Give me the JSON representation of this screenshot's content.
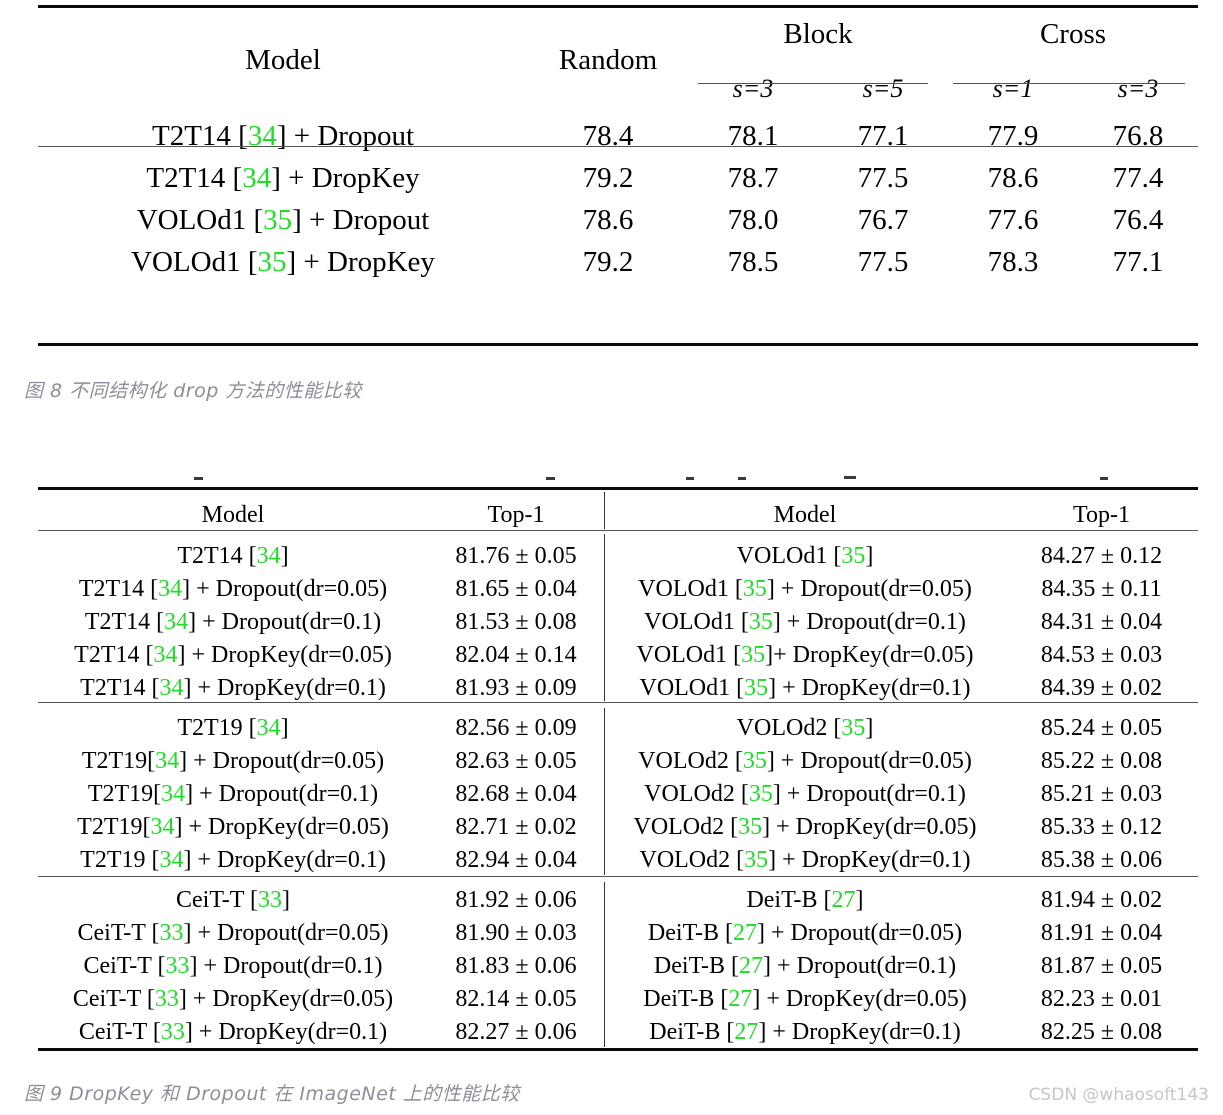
{
  "table1": {
    "columns": {
      "model": "Model",
      "random": "Random",
      "block": "Block",
      "cross": "Cross",
      "sub": [
        "s=3",
        "s=5",
        "s=1",
        "s=3"
      ]
    },
    "rows": [
      {
        "model_prefix": "T2T14 [",
        "cite": "34",
        "model_suffix": "] + Dropout",
        "random": "78.4",
        "block_s3": "78.1",
        "block_s5": "77.1",
        "cross_s1": "77.9",
        "cross_s3": "76.8"
      },
      {
        "model_prefix": "T2T14 [",
        "cite": "34",
        "model_suffix": "] + DropKey",
        "random": "79.2",
        "block_s3": "78.7",
        "block_s5": "77.5",
        "cross_s1": "78.6",
        "cross_s3": "77.4"
      },
      {
        "model_prefix": "VOLOd1 [",
        "cite": "35",
        "model_suffix": "] + Dropout",
        "random": "78.6",
        "block_s3": "78.0",
        "block_s5": "76.7",
        "cross_s1": "77.6",
        "cross_s3": "76.4"
      },
      {
        "model_prefix": "VOLOd1 [",
        "cite": "35",
        "model_suffix": "] + DropKey",
        "random": "79.2",
        "block_s3": "78.5",
        "block_s5": "77.5",
        "cross_s1": "78.3",
        "cross_s3": "77.1"
      }
    ]
  },
  "caption1": "图 8 不同结构化 drop 方法的性能比较",
  "table2": {
    "columns": {
      "model_left": "Model",
      "top1_left": "Top-1",
      "model_right": "Model",
      "top1_right": "Top-1"
    },
    "blocks": [
      {
        "left": [
          {
            "prefix": "T2T14 [",
            "cite": "34",
            "suffix": "]",
            "value": "81.76 ± 0.05",
            "bold": false
          },
          {
            "prefix": "T2T14 [",
            "cite": "34",
            "suffix": "] + Dropout(dr=0.05)",
            "value": "81.65 ± 0.04",
            "bold": false
          },
          {
            "prefix": "T2T14 [",
            "cite": "34",
            "suffix": "] + Dropout(dr=0.1)",
            "value": "81.53 ± 0.08",
            "bold": false
          },
          {
            "prefix": "T2T14 [",
            "cite": "34",
            "suffix": "] + DropKey(dr=0.05)",
            "value": "82.04 ± 0.14",
            "bold": true
          },
          {
            "prefix": "T2T14 [",
            "cite": "34",
            "suffix": "] + DropKey(dr=0.1)",
            "value": "81.93 ± 0.09",
            "bold": false
          }
        ],
        "right": [
          {
            "prefix": "VOLOd1 [",
            "cite": "35",
            "suffix": "]",
            "value": "84.27 ± 0.12",
            "bold": false
          },
          {
            "prefix": "VOLOd1 [",
            "cite": "35",
            "suffix": "] + Dropout(dr=0.05)",
            "value": "84.35 ± 0.11",
            "bold": false
          },
          {
            "prefix": "VOLOd1 [",
            "cite": "35",
            "suffix": "] + Dropout(dr=0.1)",
            "value": "84.31 ± 0.04",
            "bold": false
          },
          {
            "prefix": "VOLOd1 [",
            "cite": "35",
            "suffix": "]+ DropKey(dr=0.05)",
            "value": "84.53 ± 0.03",
            "bold": true
          },
          {
            "prefix": "VOLOd1 [",
            "cite": "35",
            "suffix": "] + DropKey(dr=0.1)",
            "value": "84.39 ± 0.02",
            "bold": false
          }
        ]
      },
      {
        "left": [
          {
            "prefix": "T2T19 [",
            "cite": "34",
            "suffix": "]",
            "value": "82.56 ± 0.09",
            "bold": false
          },
          {
            "prefix": "T2T19[",
            "cite": "34",
            "suffix": "] + Dropout(dr=0.05)",
            "value": "82.63 ± 0.05",
            "bold": false
          },
          {
            "prefix": "T2T19[",
            "cite": "34",
            "suffix": "] + Dropout(dr=0.1)",
            "value": "82.68 ± 0.04",
            "bold": false
          },
          {
            "prefix": "T2T19[",
            "cite": "34",
            "suffix": "] + DropKey(dr=0.05)",
            "value": "82.71 ± 0.02",
            "bold": false
          },
          {
            "prefix": "T2T19 [",
            "cite": "34",
            "suffix": "] + DropKey(dr=0.1)",
            "value": "82.94 ± 0.04",
            "bold": true
          }
        ],
        "right": [
          {
            "prefix": "VOLOd2 [",
            "cite": "35",
            "suffix": "]",
            "value": "85.24 ± 0.05",
            "bold": false
          },
          {
            "prefix": "VOLOd2 [",
            "cite": "35",
            "suffix": "] + Dropout(dr=0.05)",
            "value": "85.22 ± 0.08",
            "bold": false
          },
          {
            "prefix": "VOLOd2 [",
            "cite": "35",
            "suffix": "] + Dropout(dr=0.1)",
            "value": "85.21 ± 0.03",
            "bold": false
          },
          {
            "prefix": "VOLOd2 [",
            "cite": "35",
            "suffix": "] + DropKey(dr=0.05)",
            "value": "85.33 ± 0.12",
            "bold": false
          },
          {
            "prefix": "VOLOd2 [",
            "cite": "35",
            "suffix": "] + DropKey(dr=0.1)",
            "value": "85.38 ± 0.06",
            "bold": true
          }
        ]
      },
      {
        "left": [
          {
            "prefix": "CeiT-T [",
            "cite": "33",
            "suffix": "]",
            "value": "81.92 ± 0.06",
            "bold": false
          },
          {
            "prefix": "CeiT-T [",
            "cite": "33",
            "suffix": "] + Dropout(dr=0.05)",
            "value": "81.90 ± 0.03",
            "bold": false
          },
          {
            "prefix": "CeiT-T [",
            "cite": "33",
            "suffix": "] + Dropout(dr=0.1)",
            "value": "81.83 ± 0.06",
            "bold": false
          },
          {
            "prefix": "CeiT-T [",
            "cite": "33",
            "suffix": "] + DropKey(dr=0.05)",
            "value": "82.14 ± 0.05",
            "bold": false
          },
          {
            "prefix": "CeiT-T [",
            "cite": "33",
            "suffix": "] + DropKey(dr=0.1)",
            "value": "82.27 ± 0.06",
            "bold": true
          }
        ],
        "right": [
          {
            "prefix": "DeiT-B [",
            "cite": "27",
            "suffix": "]",
            "value": "81.94 ± 0.02",
            "bold": false
          },
          {
            "prefix": "DeiT-B [",
            "cite": "27",
            "suffix": "] + Dropout(dr=0.05)",
            "value": "81.91 ± 0.04",
            "bold": false
          },
          {
            "prefix": "DeiT-B [",
            "cite": "27",
            "suffix": "] + Dropout(dr=0.1)",
            "value": "81.87 ± 0.05",
            "bold": false
          },
          {
            "prefix": "DeiT-B [",
            "cite": "27",
            "suffix": "] + DropKey(dr=0.05)",
            "value": "82.23 ± 0.01",
            "bold": false
          },
          {
            "prefix": "DeiT-B [",
            "cite": "27",
            "suffix": "] + DropKey(dr=0.1)",
            "value": "82.25 ± 0.08",
            "bold": true
          }
        ]
      }
    ]
  },
  "caption2": "图 9 DropKey 和 Dropout 在 ImageNet 上的性能比较",
  "watermark": "CSDN @whaosoft143",
  "colors": {
    "citation_green": "#1fdd27",
    "caption_gray": "#8a8f99",
    "watermark_gray": "#c3c7cd",
    "rule_black": "#000000"
  }
}
